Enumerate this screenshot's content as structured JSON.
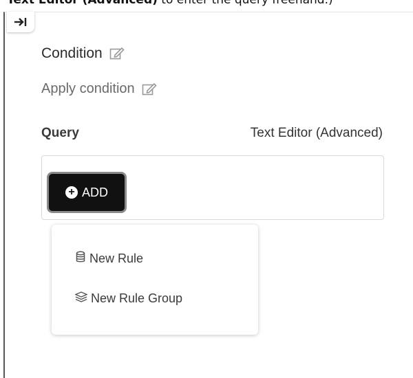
{
  "doc_text": {
    "bold": "Text Editor (Advanced)",
    "rest": " to enter the query freehand.)"
  },
  "condition": {
    "title": "Condition",
    "description": "Apply condition"
  },
  "query": {
    "label": "Query",
    "text_editor_link": "Text Editor (Advanced)",
    "add_label": "ADD"
  },
  "add_menu": {
    "items": [
      {
        "label": "New Rule",
        "icon": "rule-stack-icon"
      },
      {
        "label": "New Rule Group",
        "icon": "rule-group-icon"
      }
    ]
  },
  "colors": {
    "add_button_bg": "#111111",
    "add_button_border": "#8a8a8a",
    "text_primary": "#2b2b2b",
    "text_muted": "#6a6a6a"
  }
}
